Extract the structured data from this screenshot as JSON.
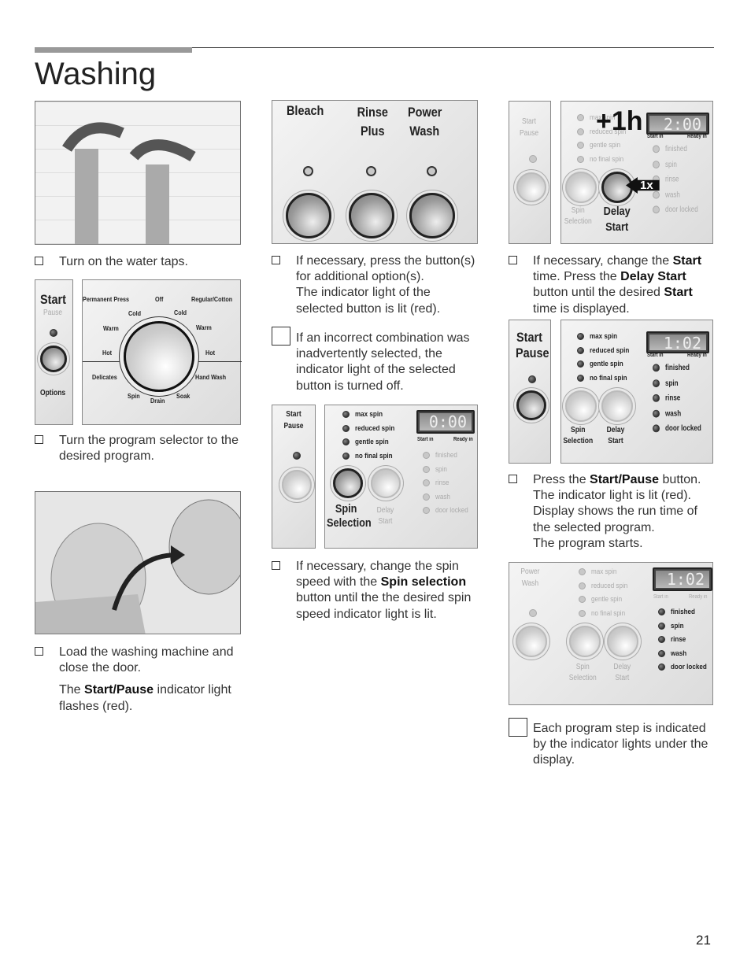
{
  "header": {
    "title": "Washing"
  },
  "col1": {
    "step1": "Turn on the water taps.",
    "step2": "Turn the program selector to the desired program.",
    "step3": "Load the washing machine and close the door.",
    "step3_note_pre": "The ",
    "step3_note_bold": "Start/Pause",
    "step3_note_post": " indicator light flashes (red).",
    "dial_panel": {
      "start": "Start",
      "pause": "Pause",
      "options": "Options",
      "labels": {
        "permanent_press": "Permanent Press",
        "off": "Off",
        "regular_cotton": "Regular/Cotton",
        "cold_l": "Cold",
        "cold_r": "Cold",
        "warm_l": "Warm",
        "warm_r": "Warm",
        "hot_l": "Hot",
        "hot_r": "Hot",
        "delicates": "Delicates",
        "hand_wash": "Hand Wash",
        "spin": "Spin",
        "drain": "Drain",
        "soak": "Soak"
      }
    }
  },
  "col2": {
    "options_panel": {
      "bleach": "Bleach",
      "rinse_plus": "Rinse Plus",
      "power_wash": "Power Wash"
    },
    "step1_a": "If necessary, press the button(s) for additional option(s).",
    "step1_b": "The indicator light of the selected button is lit (red).",
    "note": "If an incorrect combination was inadvertently selected, the indicator light of the selected button is turned off.",
    "spin_panel": {
      "start_pause": "Start Pause",
      "display": "0:00",
      "start_in": "Start in",
      "ready_in": "Ready in",
      "spin_selection": "Spin Selection",
      "delay_start": "Delay Start"
    },
    "step2_pre": "If necessary, change the spin speed with the ",
    "step2_bold": "Spin selection",
    "step2_post": " button until the the desired spin speed indicator light is lit."
  },
  "col3": {
    "delay_panel": {
      "start_pause": "Start Pause",
      "display": "2:00",
      "badge": "+1h",
      "press": "1x",
      "start_in": "Start in",
      "ready_in": "Ready in",
      "spin_selection": "Spin Selection",
      "delay_start": "Delay Start"
    },
    "step1_pre": "If necessary, change the ",
    "step1_b1": "Start",
    "step1_mid": " time. Press the ",
    "step1_b2": "Delay Start",
    "step1_mid2": " button until the desired ",
    "step1_b3": "Start",
    "step1_post": " time is displayed.",
    "start_panel": {
      "start": "Start",
      "pause": "Pause",
      "display": "1:02",
      "start_in": "Start in",
      "ready_in": "Ready in",
      "spin_selection": "Spin Selection",
      "delay_start": "Delay Start"
    },
    "step2_pre": "Press the ",
    "step2_bold": "Start/Pause",
    "step2_post": " button.",
    "step2_lines": "The indicator light is lit (red). Display shows the run time of the selected program.",
    "step2_last": "The program starts.",
    "run_panel": {
      "power_wash": "Power Wash",
      "display": "1:02",
      "start_in": "Start in",
      "ready_in": "Ready in",
      "spin_selection": "Spin Selection",
      "delay_start": "Delay Start"
    },
    "note": "Each program step is indicated by the indicator lights under the display."
  },
  "spin_options": [
    "max spin",
    "reduced spin",
    "gentle spin",
    "no final spin"
  ],
  "status_lights": [
    "finished",
    "spin",
    "rinse",
    "wash",
    "door locked"
  ],
  "page_number": "21"
}
